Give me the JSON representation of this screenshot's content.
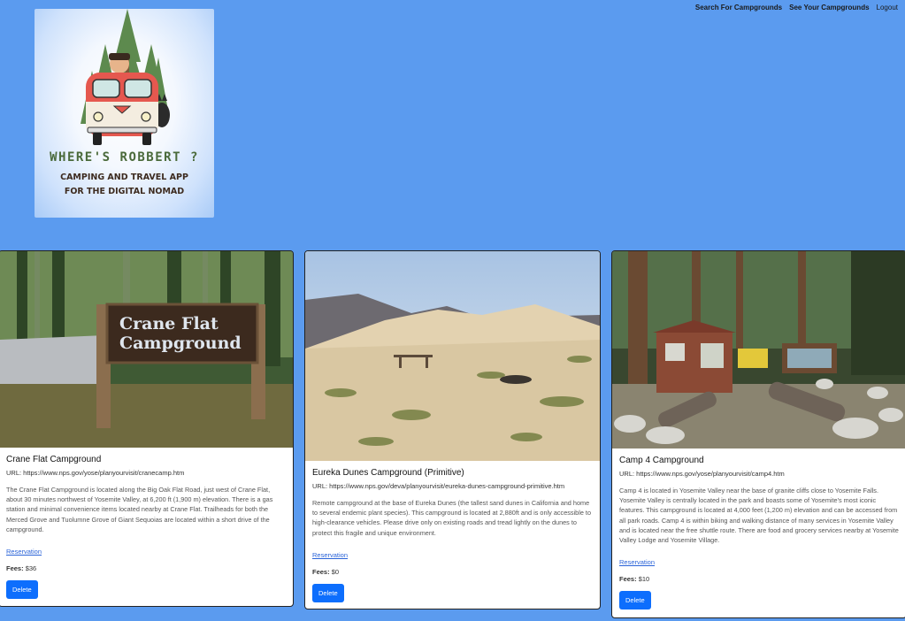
{
  "nav": {
    "search": "Search For Campgrounds",
    "your": "See Your Campgrounds",
    "logout": "Logout"
  },
  "logo": {
    "title": "WHERE'S ROBBERT ?",
    "line1": "CAMPING AND TRAVEL APP",
    "line2": "FOR THE DIGITAL NOMAD"
  },
  "cards": [
    {
      "title": "Crane Flat Campground",
      "url": "URL: https://www.nps.gov/yose/planyourvisit/cranecamp.htm",
      "description": "The Crane Flat Campground is located along the Big Oak Flat Road, just west of Crane Flat, about 30 minutes northwest of Yosemite Valley, at 6,200 ft (1,900 m) elevation. There is a gas station and minimal convenience items located nearby at Crane Flat. Trailheads for both the Merced Grove and Tuolumne Grove of Giant Sequoias are located within a short drive of the campground.",
      "sign_line1": "Crane Flat",
      "sign_line2": "Campground",
      "link": "Reservation",
      "fees_label": "Fees:",
      "fees": "$36",
      "button": "Delete"
    },
    {
      "title": "Eureka Dunes Campground (Primitive)",
      "url": "URL: https://www.nps.gov/deva/planyourvisit/eureka-dunes-campground-primitive.htm",
      "description": "Remote campground at the base of Eureka Dunes (the tallest sand dunes in California and home to several endemic plant species). This campground is located at 2,880ft and is only accessible to high-clearance vehicles. Please drive only on existing roads and tread lightly on the dunes to protect this fragile and unique environment.",
      "link": "Reservation",
      "fees_label": "Fees:",
      "fees": "$0",
      "button": "Delete"
    },
    {
      "title": "Camp 4 Campground",
      "url": "URL: https://www.nps.gov/yose/planyourvisit/camp4.htm",
      "description": "Camp 4 is located in Yosemite Valley near the base of granite cliffs close to Yosemite Falls. Yosemite Valley is centrally located in the park and boasts some of Yosemite's most iconic features. This campground is located at 4,000 feet (1,200 m) elevation and can be accessed from all park roads. Camp 4 is within biking and walking distance of many services in Yosemite Valley and is located near the free shuttle route. There are food and grocery services nearby at Yosemite Valley Lodge and Yosemite Village.",
      "link": "Reservation",
      "fees_label": "Fees:",
      "fees": "$10",
      "button": "Delete"
    }
  ],
  "colors": {
    "background": "#5b9bef",
    "button": "#0d6efd",
    "link": "#2a63d8"
  }
}
